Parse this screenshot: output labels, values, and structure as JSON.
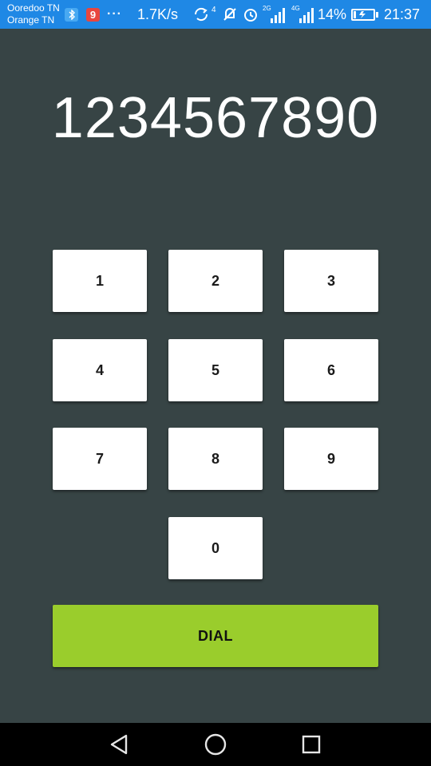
{
  "status_bar": {
    "carriers": [
      "Ooredoo TN",
      "Orange TN"
    ],
    "app_badge_red": "9",
    "more": "···",
    "net_speed": "1.7K/s",
    "sync_superscript": "4",
    "network_2g": "2G",
    "network_4g": "4G",
    "battery_level": 0.14,
    "battery_pct": "14%",
    "clock": "21:37",
    "icons": [
      "bluetooth-icon",
      "app-badge-icon",
      "sync-icon",
      "mute-icon",
      "alarm-icon",
      "signal-icon",
      "battery-charging-icon"
    ]
  },
  "display": {
    "number": "1234567890"
  },
  "keypad": {
    "keys": [
      "1",
      "2",
      "3",
      "4",
      "5",
      "6",
      "7",
      "8",
      "9",
      "0"
    ]
  },
  "dial_label": "DIAL",
  "nav_bar": {
    "icons": [
      "back-icon",
      "home-icon",
      "recents-icon"
    ]
  },
  "colors": {
    "background": "#374445",
    "status_bar": "#1f88e5",
    "key": "#ffffff",
    "dial": "#9acd2c",
    "nav_bar": "#000000"
  }
}
